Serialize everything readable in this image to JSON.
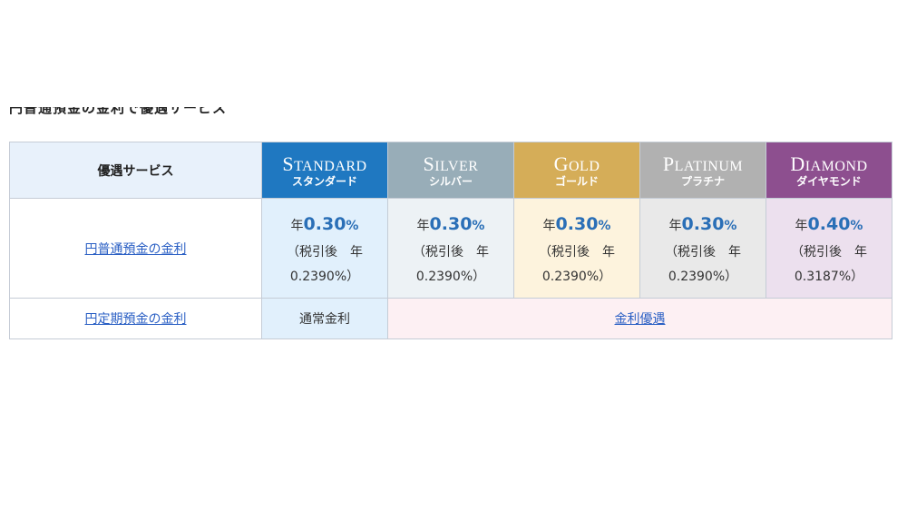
{
  "heading_cut": "円普通預金の金利で優遇サービス",
  "table": {
    "header_label": "優遇サービス",
    "tiers": [
      {
        "en_first": "S",
        "en_rest": "TANDARD",
        "jp": "スタンダード",
        "color": "#1f78c1"
      },
      {
        "en_first": "S",
        "en_rest": "ILVER",
        "jp": "シルバー",
        "color": "#98adb8"
      },
      {
        "en_first": "G",
        "en_rest": "OLD",
        "jp": "ゴールド",
        "color": "#d5ad58"
      },
      {
        "en_first": "P",
        "en_rest": "LATINUM",
        "jp": "プラチナ",
        "color": "#b1b1b1"
      },
      {
        "en_first": "D",
        "en_rest": "IAMOND",
        "jp": "ダイヤモンド",
        "color": "#8d4f8f"
      }
    ],
    "ordinary": {
      "label": "円普通預金の金利",
      "rates": [
        {
          "prefix": "年",
          "value": "0.30",
          "pct": "%",
          "line2": "（税引後　年",
          "line3": "0.2390%）"
        },
        {
          "prefix": "年",
          "value": "0.30",
          "pct": "%",
          "line2": "（税引後　年",
          "line3": "0.2390%）"
        },
        {
          "prefix": "年",
          "value": "0.30",
          "pct": "%",
          "line2": "（税引後　年",
          "line3": "0.2390%）"
        },
        {
          "prefix": "年",
          "value": "0.30",
          "pct": "%",
          "line2": "（税引後　年",
          "line3": "0.2390%）"
        },
        {
          "prefix": "年",
          "value": "0.40",
          "pct": "%",
          "line2": "（税引後　年",
          "line3": "0.3187%）"
        }
      ]
    },
    "time_deposit": {
      "label": "円定期預金の金利",
      "standard": "通常金利",
      "others": "金利優遇"
    }
  }
}
